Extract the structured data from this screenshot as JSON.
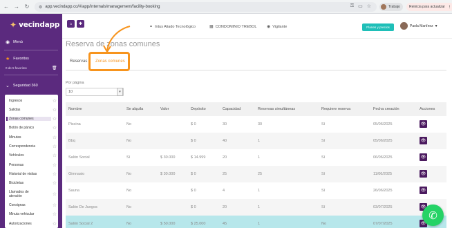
{
  "browser": {
    "url": "app.vecindapp.co/#/app/internals/management/facility-booking",
    "profile_label": "Trabajo",
    "update_label": "Reinicia para actualizar"
  },
  "sidebar": {
    "logo_text": "vecindapp",
    "menu_label": "Menú",
    "favoritos_label": "Favoritos",
    "favoritos_count": "0 de 5 favoritos",
    "section_label": "Seguridad 360",
    "items": [
      {
        "label": "Ingresos"
      },
      {
        "label": "Salidas"
      },
      {
        "label": "Zonas comunes"
      },
      {
        "label": "Botón de pánico"
      },
      {
        "label": "Minutas"
      },
      {
        "label": "Correspondencia"
      },
      {
        "label": "Vehículos"
      },
      {
        "label": "Personas"
      },
      {
        "label": "Historial de visitas"
      },
      {
        "label": "Bicicletas"
      },
      {
        "label": "Llamados de atención"
      },
      {
        "label": "Consignas"
      },
      {
        "label": "Minuta vehicular"
      },
      {
        "label": "Autorizaciones"
      }
    ]
  },
  "topbar": {
    "company": "Intus Aliado Tecnológico",
    "condominio": "CONDOMINIO TREBOL",
    "role": "Vigilante",
    "planes_label": "Planes y precios",
    "user_name": "Paola Martínez"
  },
  "page": {
    "title": "Reserva de zonas comunes",
    "tabs": [
      {
        "label": "Reservas"
      },
      {
        "label": "Zonas comunes"
      }
    ],
    "per_page_label": "Por página",
    "per_page_value": "10"
  },
  "table": {
    "headers": [
      "Nombre",
      "Se alquila",
      "Valor",
      "Depósito",
      "Capacidad",
      "Reservas simultáneas",
      "Requiere reserva",
      "Fecha creación",
      "Acciones"
    ],
    "rows": [
      [
        "Piscina",
        "No",
        "",
        "$ 0",
        "30",
        "30",
        "Sí",
        "05/06/2025"
      ],
      [
        "Bbq",
        "No",
        "",
        "$ 0",
        "40",
        "1",
        "Sí",
        "05/06/2025"
      ],
      [
        "Salón Social",
        "Sí",
        "$ 30.000",
        "$ 14.999",
        "20",
        "1",
        "Sí",
        "06/06/2025"
      ],
      [
        "Gimnasio",
        "No",
        "$ 30.000",
        "$ 0",
        "25",
        "25",
        "Sí",
        "11/06/2025"
      ],
      [
        "Sauna",
        "No",
        "",
        "$ 0",
        "4",
        "1",
        "Sí",
        "26/06/2025"
      ],
      [
        "Salón De Juegos",
        "No",
        "",
        "$ 0",
        "20",
        "1",
        "Sí",
        "03/07/2025"
      ],
      [
        "Salón Social 2",
        "No",
        "$ 50.000",
        "$ 25.000",
        "45",
        "1",
        "No",
        "07/07/2025"
      ]
    ]
  },
  "colors": {
    "brand_purple": "#5b2a7e",
    "accent_orange": "#f7941d",
    "teal": "#1fbfb8",
    "whatsapp_green": "#25d366"
  }
}
